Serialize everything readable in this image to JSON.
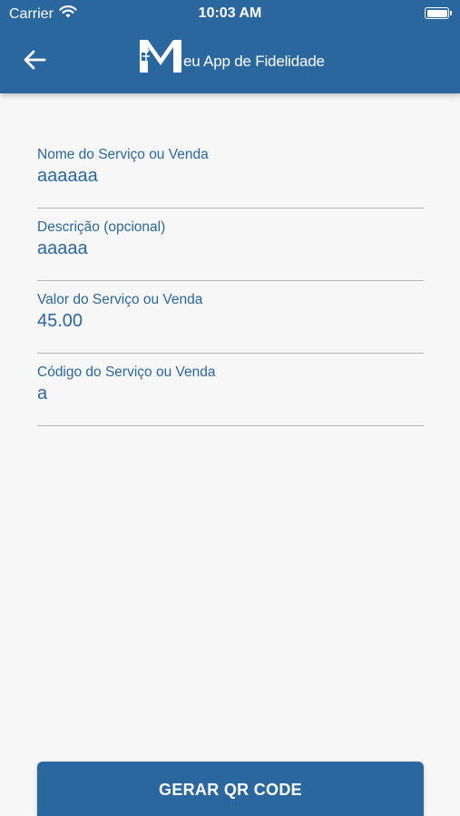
{
  "status_bar": {
    "carrier": "Carrier",
    "time": "10:03 AM"
  },
  "header": {
    "logo_text": "eu App de Fidelidade",
    "brand_color": "#2a679e"
  },
  "form": {
    "fields": [
      {
        "label": "Nome do Serviço ou Venda",
        "value": "aaaaaa"
      },
      {
        "label": "Descrição (opcional)",
        "value": "aaaaa"
      },
      {
        "label": "Valor do Serviço ou Venda",
        "value": "45.00"
      },
      {
        "label": "Código do Serviço ou Venda",
        "value": "a"
      }
    ]
  },
  "actions": {
    "submit_label": "GERAR QR CODE"
  }
}
